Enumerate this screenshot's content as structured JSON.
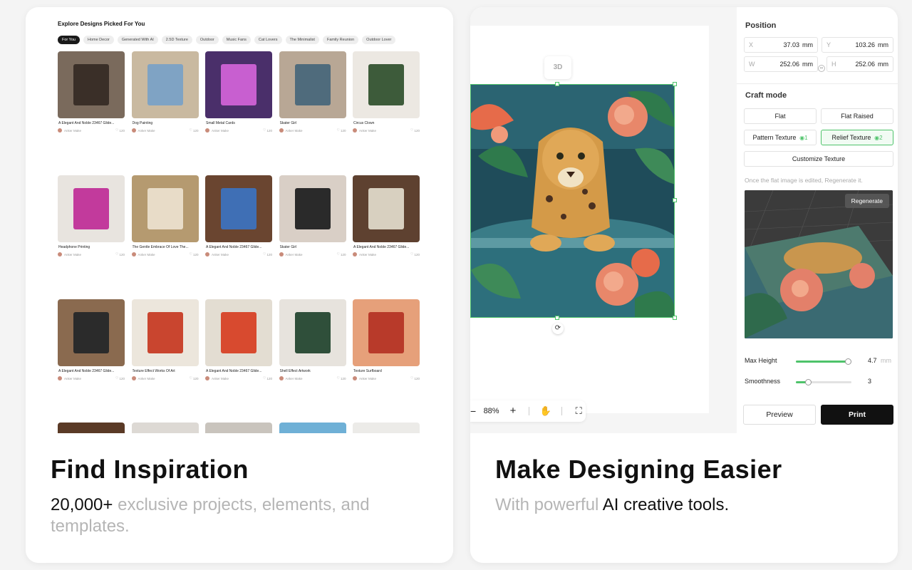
{
  "left_card": {
    "explore": {
      "title": "Explore Designs Picked For You",
      "chips": [
        {
          "label": "For You",
          "active": true
        },
        {
          "label": "Home Decor",
          "active": false
        },
        {
          "label": "Generated With AI",
          "active": false
        },
        {
          "label": "2.5D Texture",
          "active": false
        },
        {
          "label": "Outdoor",
          "active": false
        },
        {
          "label": "Music Fans",
          "active": false
        },
        {
          "label": "Cat Lovers",
          "active": false
        },
        {
          "label": "The Minimalist",
          "active": false
        },
        {
          "label": "Family Reunion",
          "active": false
        },
        {
          "label": "Outdoor Lover",
          "active": false
        }
      ],
      "tiles": [
        {
          "name": "A Elegant And Noble 23467 Glide...",
          "author": "Anker Make",
          "likes": "120",
          "bg": "#7a6a5c",
          "accent": "#3a2f28"
        },
        {
          "name": "Dog Painting",
          "author": "Anker Make",
          "likes": "120",
          "bg": "#c9b9a0",
          "accent": "#7fa3c4"
        },
        {
          "name": "Small Metal Cards",
          "author": "Anker Make",
          "likes": "120",
          "bg": "#4a2f6a",
          "accent": "#c85fd0"
        },
        {
          "name": "Skater Girl",
          "author": "Anker Make",
          "likes": "120",
          "bg": "#b8a795",
          "accent": "#4f6b7c"
        },
        {
          "name": "Circus Clown",
          "author": "Anker Make",
          "likes": "120",
          "bg": "#ece8e2",
          "accent": "#3d5b3a"
        },
        {
          "name": "Headphone Printing",
          "author": "Anker Make",
          "likes": "120",
          "bg": "#e8e4df",
          "accent": "#c23a9c"
        },
        {
          "name": "The Gentle Embrace Of Love The...",
          "author": "Anker Make",
          "likes": "120",
          "bg": "#b59a70",
          "accent": "#e8dcc8"
        },
        {
          "name": "A Elegant And Noble 23467 Glide...",
          "author": "Anker Make",
          "likes": "120",
          "bg": "#6a4530",
          "accent": "#3f6fb5"
        },
        {
          "name": "Skater Girl",
          "author": "Anker Make",
          "likes": "120",
          "bg": "#d9cfc6",
          "accent": "#2a2a2a"
        },
        {
          "name": "A Elegant And Noble 23467 Glide...",
          "author": "Anker Make",
          "likes": "120",
          "bg": "#5e4130",
          "accent": "#d8d0c0"
        },
        {
          "name": "A Elegant And Noble 23467 Glide...",
          "author": "Anker Make",
          "likes": "120",
          "bg": "#8a6a4f",
          "accent": "#2b2b2b"
        },
        {
          "name": "Texture Effect Works Of Art",
          "author": "Anker Make",
          "likes": "120",
          "bg": "#ece6dc",
          "accent": "#c9452f"
        },
        {
          "name": "A Elegant And Noble 23467 Glide...",
          "author": "Anker Make",
          "likes": "120",
          "bg": "#e3ddd2",
          "accent": "#d84a2f"
        },
        {
          "name": "Shell Effect Artwork",
          "author": "Anker Make",
          "likes": "120",
          "bg": "#e7e3dd",
          "accent": "#2f4f3a"
        },
        {
          "name": "Texture Surfboard",
          "author": "Anker Make",
          "likes": "120",
          "bg": "#e6a07a",
          "accent": "#b83a2a"
        }
      ],
      "stub_colors": [
        "#5a3a26",
        "#ddd9d4",
        "#c9c4bd",
        "#6fb0d6",
        "#ecebe8"
      ]
    },
    "headline": "Find Inspiration",
    "sub_strong": "20,000+",
    "sub_rest": " exclusive projects, elements, and templates."
  },
  "right_card": {
    "btn_3d": "3D",
    "rotate_icon": "⟳",
    "zoom": {
      "minus": "−",
      "value": "88%",
      "plus": "+",
      "hand_icon": "✋",
      "fit_icon": "⛶"
    },
    "panel": {
      "position_title": "Position",
      "fields": [
        {
          "label": "X",
          "value": "37.03",
          "unit": "mm"
        },
        {
          "label": "Y",
          "value": "103.26",
          "unit": "mm"
        },
        {
          "label": "W",
          "value": "252.06",
          "unit": "mm"
        },
        {
          "label": "H",
          "value": "252.06",
          "unit": "mm"
        }
      ],
      "craft_title": "Craft mode",
      "modes": {
        "flat": "Flat",
        "flat_raised": "Flat Raised",
        "pattern_texture": "Pattern Texture",
        "pattern_count": "1",
        "relief_texture": "Relief Texture",
        "relief_count": "2",
        "customize": "Customize Texture"
      },
      "hint": "Once the flat image is edited, Regenerate it.",
      "regenerate": "Regenerate",
      "max_height": {
        "label": "Max Height",
        "value": "4.7",
        "unit": "mm",
        "level": 0.94
      },
      "smoothness": {
        "label": "Smoothness",
        "value": "3",
        "level": 0.22
      },
      "preview_btn": "Preview",
      "print_btn": "Print"
    },
    "headline": "Make Designing Easier",
    "sub_light": "With powerful ",
    "sub_strong": "AI creative tools."
  },
  "colors": {
    "accent_green": "#4ec36a"
  }
}
